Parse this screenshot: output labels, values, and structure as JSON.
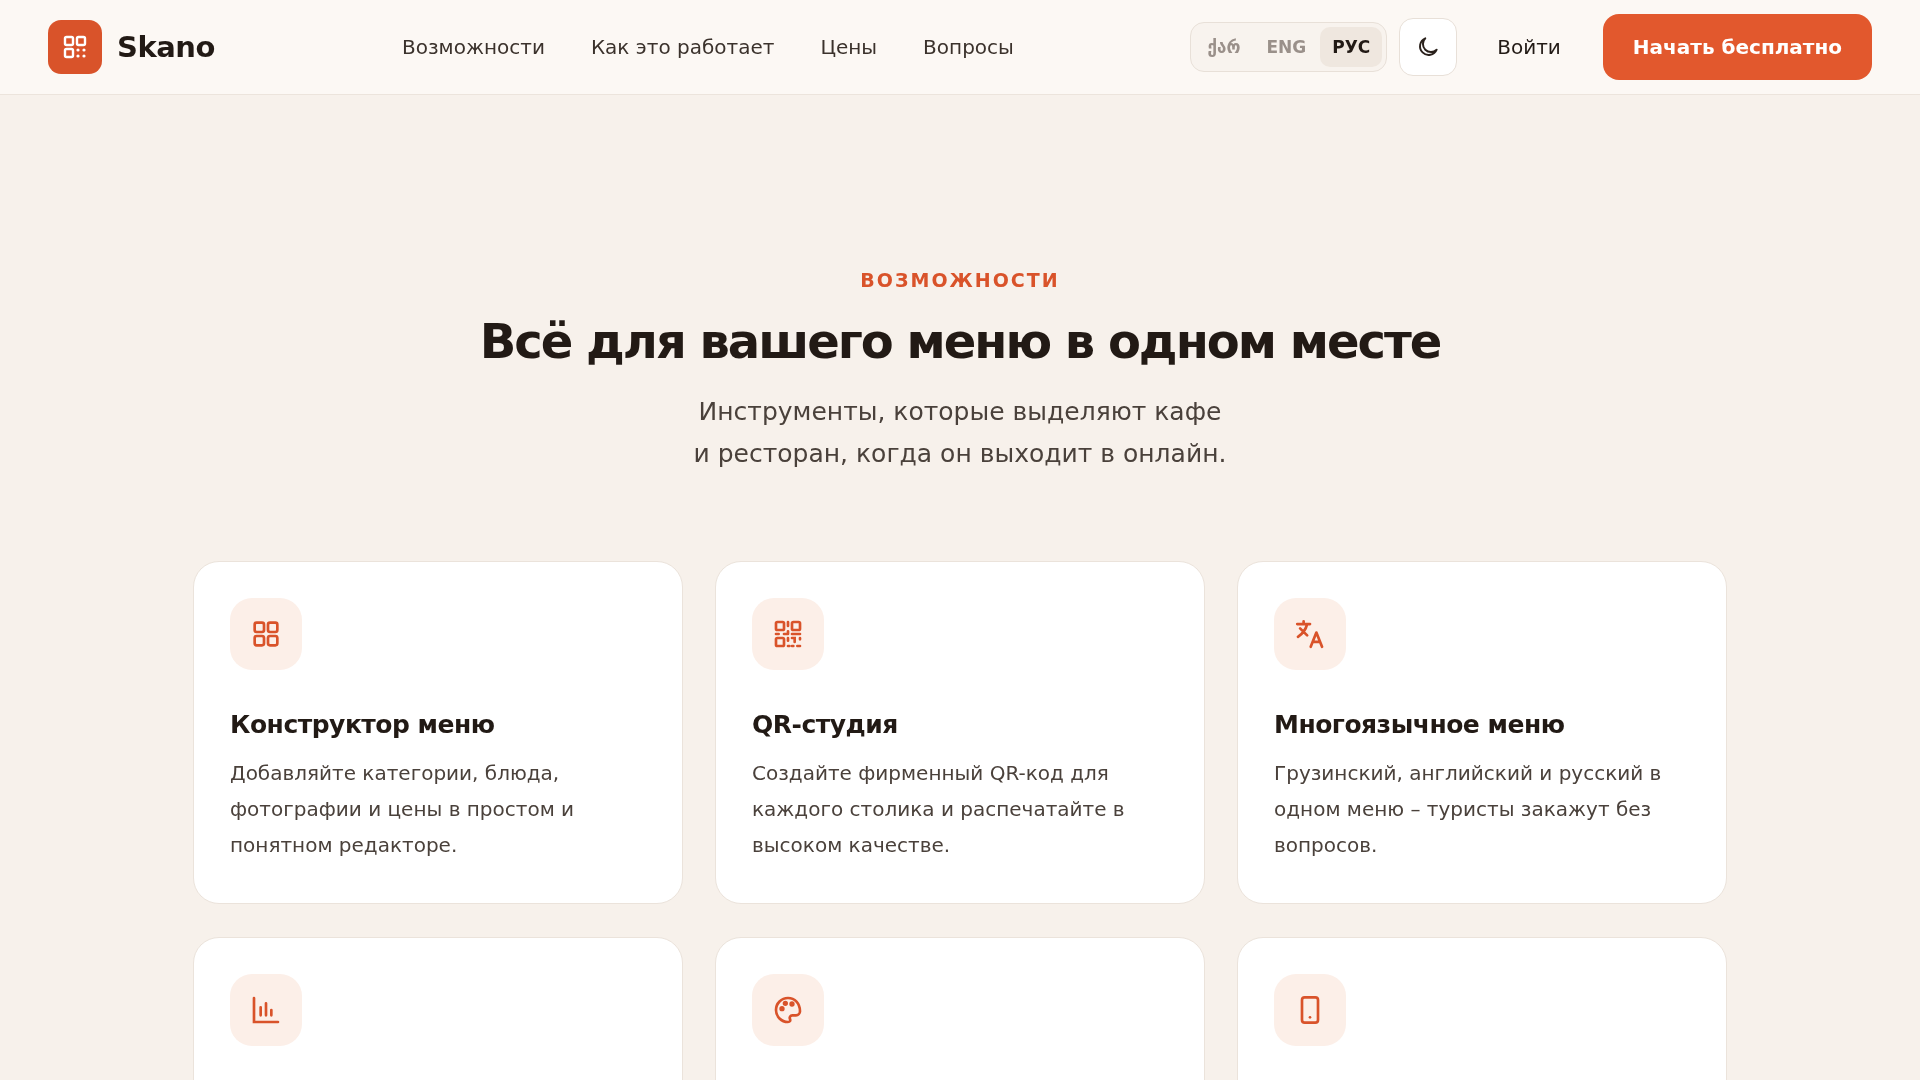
{
  "header": {
    "brand": "Skano",
    "nav": [
      {
        "label": "Возможности"
      },
      {
        "label": "Как это работает"
      },
      {
        "label": "Цены"
      },
      {
        "label": "Вопросы"
      }
    ],
    "languages": [
      {
        "label": "ქარ",
        "selected": false
      },
      {
        "label": "ENG",
        "selected": false
      },
      {
        "label": "РУС",
        "selected": true
      }
    ],
    "login": "Войти",
    "cta": "Начать бесплатно"
  },
  "section": {
    "eyebrow": "ВОЗМОЖНОСТИ",
    "title": "Всё для вашего меню в одном месте",
    "subtitle": [
      "Инструменты, которые выделяют кафе",
      "и ресторан, когда он выходит в онлайн."
    ],
    "features": [
      {
        "kind": "full",
        "title": "Конструктор меню",
        "description": "Добавляйте категории, блюда, фотографии и цены в простом и понятном редакторе."
      },
      {
        "kind": "full",
        "title": "QR-студия",
        "description": "Создайте фирменный QR-код для каждого столика и распечатайте в высоком качестве."
      },
      {
        "kind": "full",
        "title": "Многоязычное меню",
        "description": "Грузинский, английский и русский в одном меню – туристы закажут без вопросов."
      },
      {
        "kind": "cut-off"
      },
      {
        "kind": "cut-off"
      },
      {
        "kind": "cut-off"
      }
    ]
  }
}
